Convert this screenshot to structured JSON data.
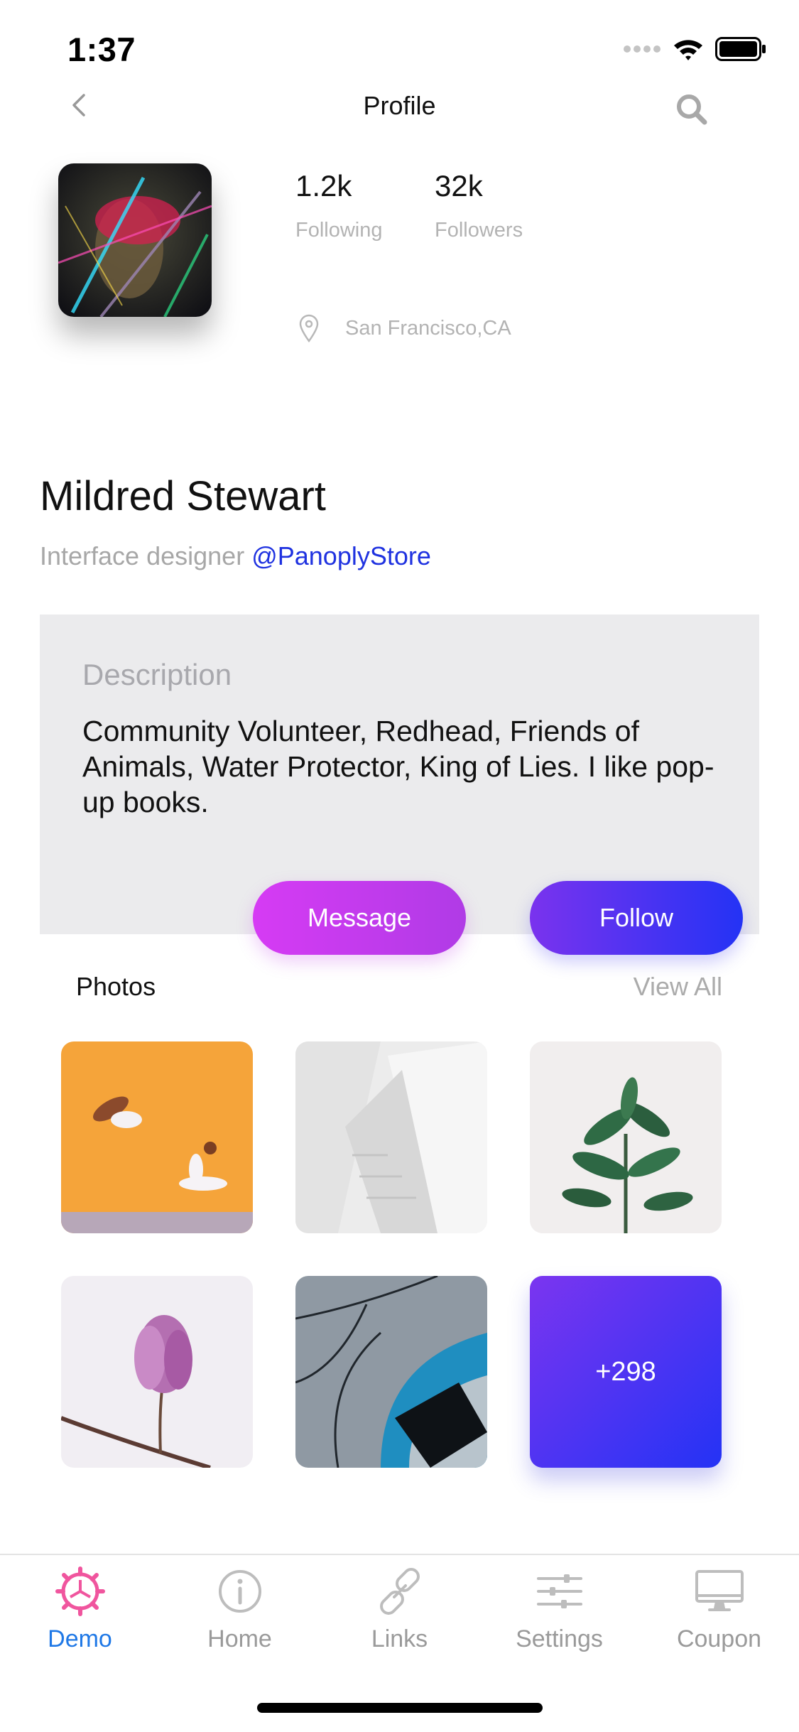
{
  "status": {
    "time": "1:37"
  },
  "nav": {
    "title": "Profile"
  },
  "profile": {
    "following_count": "1.2k",
    "following_label": "Following",
    "followers_count": "32k",
    "followers_label": "Followers",
    "location": "San Francisco,CA",
    "name": "Mildred Stewart",
    "role": "Interface designer",
    "handle": "@PanoplyStore"
  },
  "description": {
    "title": "Description",
    "text": "Community Volunteer, Redhead, Friends of Animals, Water Protector, King of Lies. I like pop-up books."
  },
  "actions": {
    "message_label": "Message",
    "follow_label": "Follow"
  },
  "photos": {
    "title": "Photos",
    "view_all": "View All",
    "more_count": "+298"
  },
  "tabs": [
    {
      "label": "Demo",
      "icon": "gear-icon"
    },
    {
      "label": "Home",
      "icon": "info-icon"
    },
    {
      "label": "Links",
      "icon": "link-icon"
    },
    {
      "label": "Settings",
      "icon": "sliders-icon"
    },
    {
      "label": "Coupon",
      "icon": "monitor-icon"
    }
  ],
  "colors": {
    "accent_blue": "#1f78e6",
    "handle_blue": "#1f32e0",
    "message_gradient": "#d63bf4",
    "follow_gradient": "#2433f5",
    "tab_active_icon": "#f0559e"
  }
}
